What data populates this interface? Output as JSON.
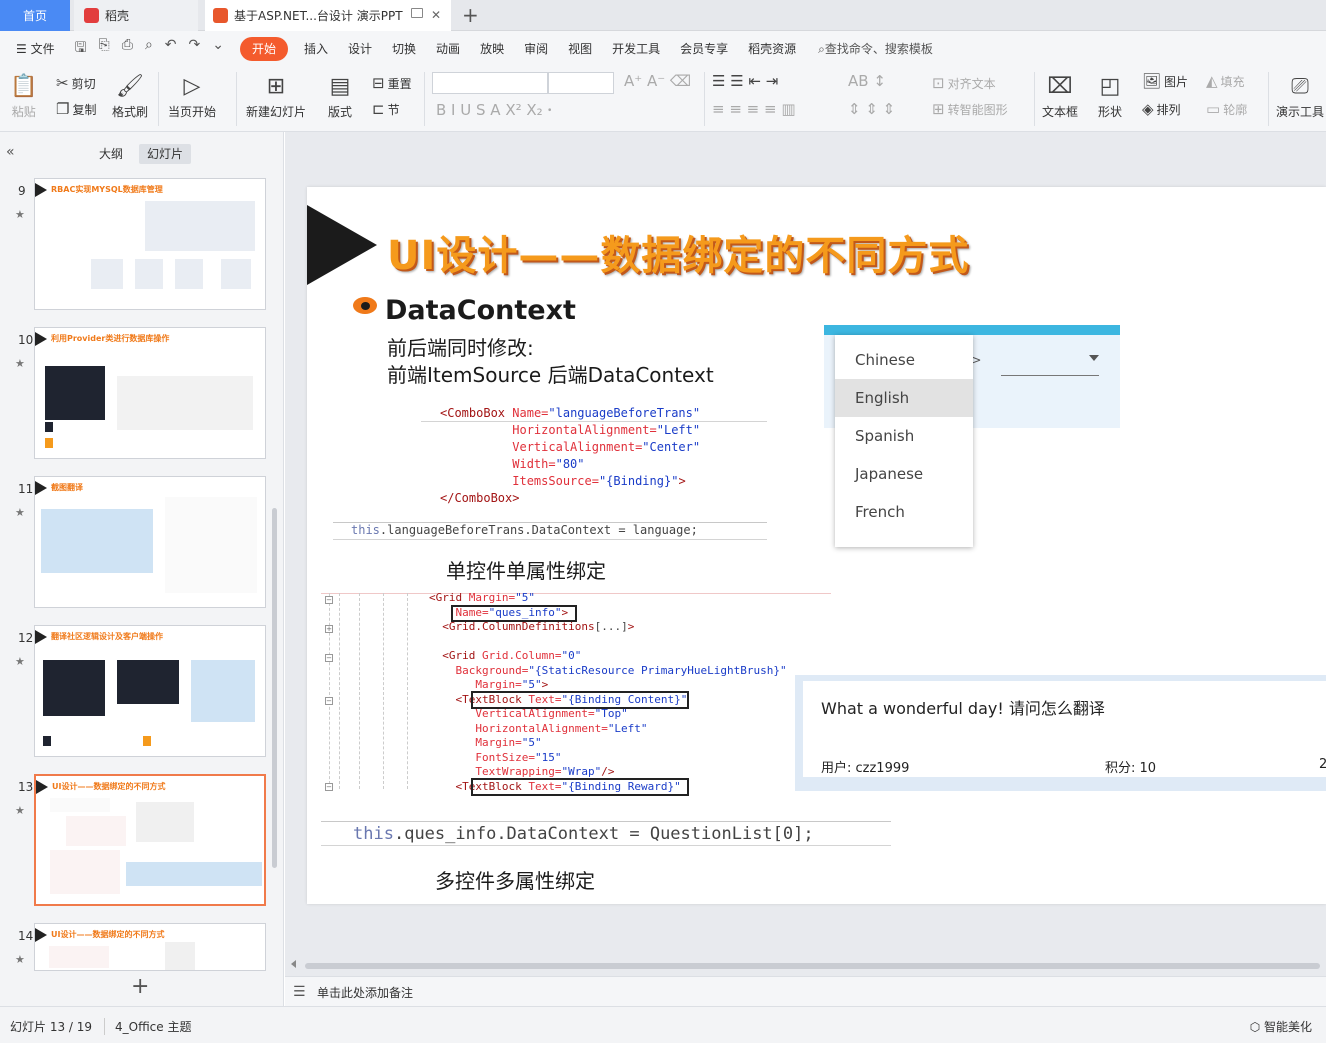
{
  "tabs": {
    "home": "首页",
    "daoke": "稻壳",
    "doc": "基于ASP.NET...台设计 演示PPT"
  },
  "menu": {
    "file": "文件",
    "items": [
      "开始",
      "插入",
      "设计",
      "切换",
      "动画",
      "放映",
      "审阅",
      "视图",
      "开发工具",
      "会员专享",
      "稻壳资源"
    ],
    "active_index": 0,
    "search": "查找命令、搜索模板"
  },
  "ribbon": {
    "paste": "粘贴",
    "cut": "剪切",
    "copy": "复制",
    "format_painter": "格式刷",
    "from_start": "当页开始",
    "new_slide": "新建幻灯片",
    "layout": "版式",
    "reset": "重置",
    "section": "节",
    "align_text": "对齐文本",
    "smart_shape": "转智能图形",
    "text_box": "文本框",
    "shape": "形状",
    "picture": "图片",
    "fill": "填充",
    "arrange": "排列",
    "outline": "轮廓",
    "present_tools": "演示工具"
  },
  "left_panel": {
    "tab_outline": "大纲",
    "tab_slides": "幻灯片",
    "thumbnails": [
      {
        "number": "9",
        "title": "RBAC实现MYSQL数据库管理",
        "selected": false
      },
      {
        "number": "10",
        "title": "利用Provider类进行数据库操作",
        "selected": false
      },
      {
        "number": "11",
        "title": "截图翻译",
        "selected": false
      },
      {
        "number": "12",
        "title": "翻译社区逻辑设计及客户端操作",
        "selected": false
      },
      {
        "number": "13",
        "title": "UI设计——数据绑定的不同方式",
        "selected": true
      },
      {
        "number": "14",
        "title": "UI设计——数据绑定的不同方式",
        "selected": false
      }
    ]
  },
  "slide": {
    "title": "UI设计——数据绑定的不同方式",
    "bullet_heading": "DataContext",
    "line1": "前后端同时修改:",
    "line2": "前端ItemSource 后端DataContext",
    "caption1": "单控件单属性绑定",
    "caption2": "多控件多属性绑定",
    "code1_assign": "this.languageBeforeTrans.DataContext = language;",
    "code2_assign": "this.ques_info.DataContext = QuestionList[0];",
    "combo_options": [
      "Chinese",
      "English",
      "Spanish",
      "Japanese",
      "French"
    ],
    "combo_selected_index": 1,
    "combo_arrow": "->",
    "question_text": "What a wonderful day!  请问怎么翻译",
    "question_user": "用户:  czz1999",
    "question_score": "积分:  10",
    "question_tail": "2"
  },
  "notes": {
    "placeholder": "单击此处添加备注"
  },
  "status": {
    "slide_counter": "幻灯片 13 / 19",
    "theme": "4_Office 主题",
    "beautify": "智能美化"
  },
  "colors": {
    "accent": "#f45b2d",
    "title_orange": "#f59a1c",
    "tab_blue": "#4a8af4",
    "combo_bar": "#3cb6e0"
  }
}
